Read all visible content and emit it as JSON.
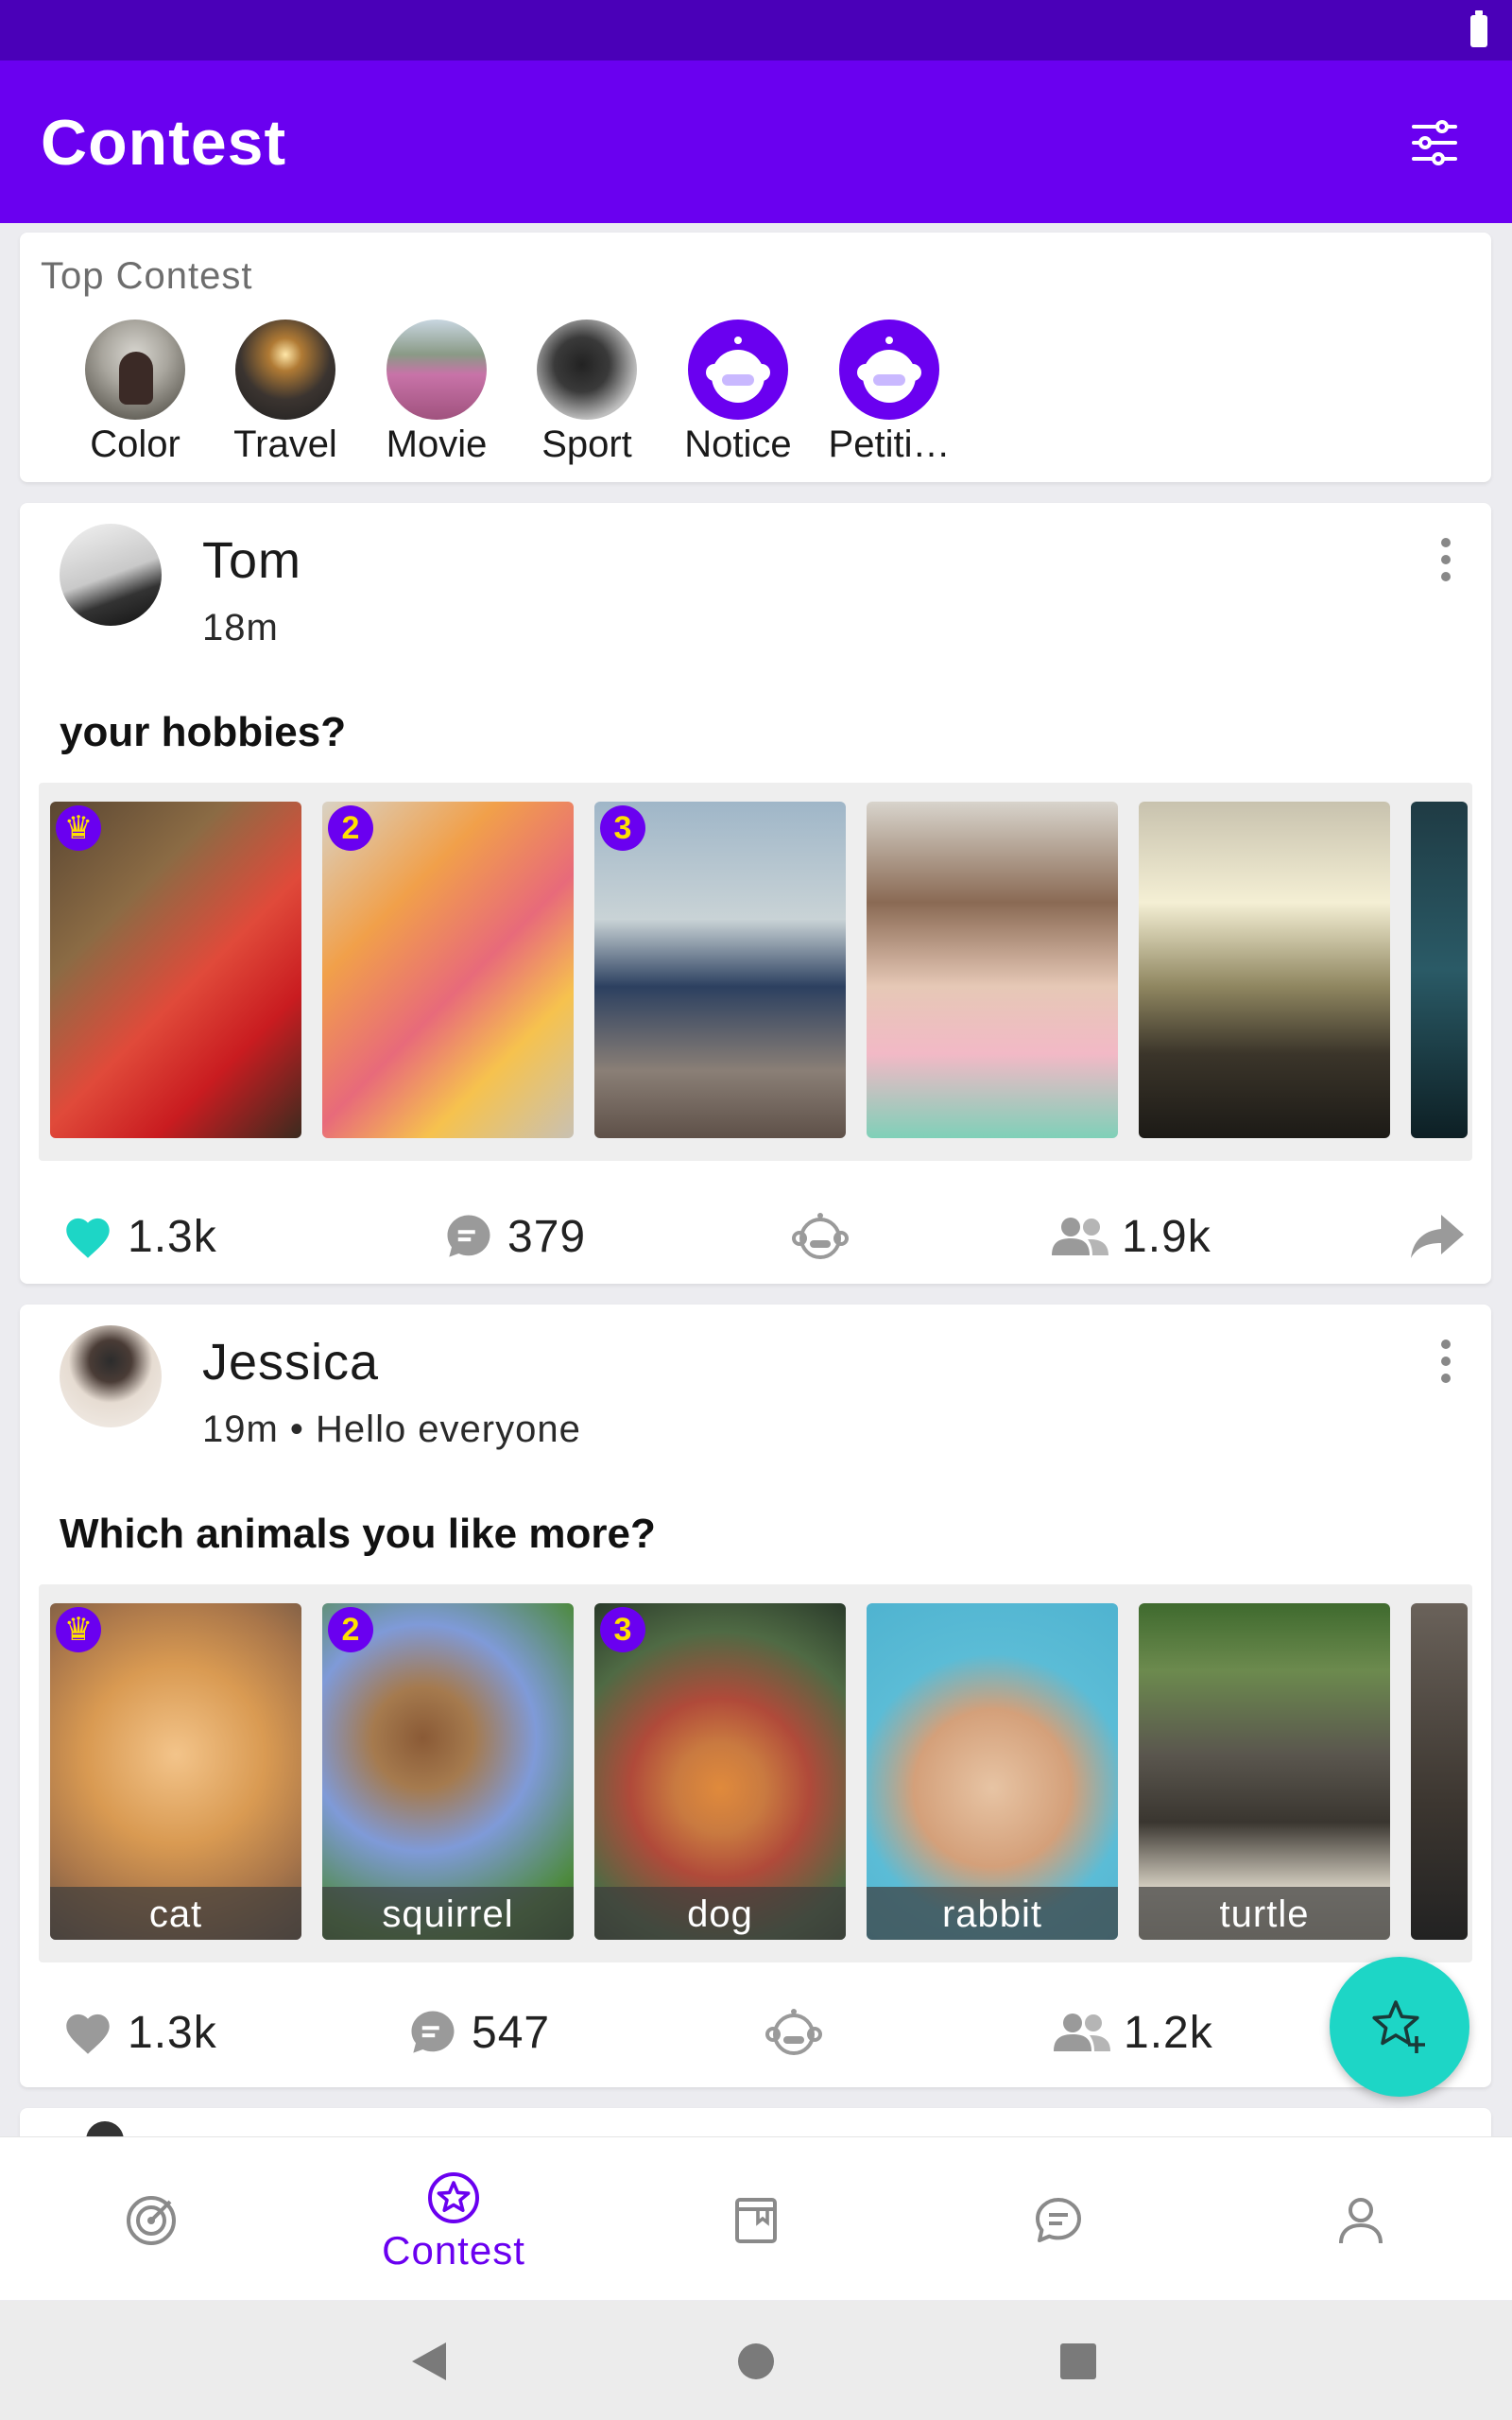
{
  "app": {
    "title": "Contest",
    "accent": "#6a00f0",
    "status_bar_color": "#4a00b8",
    "fab_color": "#1dd6c6"
  },
  "top_contest": {
    "label": "Top Contest",
    "items": [
      {
        "name": "Color"
      },
      {
        "name": "Travel"
      },
      {
        "name": "Movie"
      },
      {
        "name": "Sport"
      },
      {
        "name": "Notice"
      },
      {
        "name": "Petiti…"
      }
    ]
  },
  "posts": [
    {
      "author": "Tom",
      "meta": "18m",
      "question": "your hobbies?",
      "images": [
        {
          "rank": "crown",
          "caption": ""
        },
        {
          "rank": "2",
          "caption": ""
        },
        {
          "rank": "3",
          "caption": ""
        },
        {
          "rank": "",
          "caption": ""
        },
        {
          "rank": "",
          "caption": ""
        }
      ],
      "likes": "1.3k",
      "liked": true,
      "comments": "379",
      "participants": "1.9k"
    },
    {
      "author": "Jessica",
      "meta": "19m • Hello everyone",
      "question": "Which animals you like more?",
      "images": [
        {
          "rank": "crown",
          "caption": "cat"
        },
        {
          "rank": "2",
          "caption": "squirrel"
        },
        {
          "rank": "3",
          "caption": "dog"
        },
        {
          "rank": "",
          "caption": "rabbit"
        },
        {
          "rank": "",
          "caption": "turtle"
        }
      ],
      "likes": "1.3k",
      "liked": false,
      "comments": "547",
      "participants": "1.2k"
    }
  ],
  "bottom_nav": {
    "items": [
      {
        "icon": "target-icon",
        "label": ""
      },
      {
        "icon": "star-badge-icon",
        "label": "Contest",
        "active": true
      },
      {
        "icon": "bookmark-book-icon",
        "label": ""
      },
      {
        "icon": "chat-icon",
        "label": ""
      },
      {
        "icon": "profile-icon",
        "label": ""
      }
    ]
  },
  "system_nav": [
    "back-icon",
    "home-icon",
    "recents-icon"
  ]
}
